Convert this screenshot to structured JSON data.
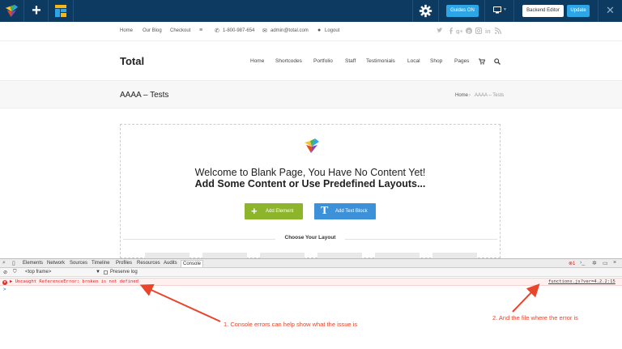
{
  "editor_toolbar": {
    "guides_label": "Guides ON",
    "backend_label": "Backend Editor",
    "update_label": "Update",
    "icons": [
      "vc-logo-icon",
      "add-element-icon",
      "templates-icon",
      "gear-icon",
      "monitor-icon",
      "close-icon"
    ]
  },
  "topbar": {
    "nav": [
      "Home",
      "Our Blog",
      "Checkout"
    ],
    "phone": "1-800-987-654",
    "email": "admin@total.com",
    "logout": "Logout",
    "social": [
      "twitter-icon",
      "facebook-icon",
      "google-plus-icon",
      "pinterest-icon",
      "instagram-icon",
      "linkedin-icon",
      "rss-icon"
    ]
  },
  "header": {
    "brand": "Total",
    "menu": [
      "Home",
      "Shortcodes",
      "Portfolio",
      "Staff",
      "Testimonials",
      "Local",
      "Shop",
      "Pages"
    ]
  },
  "page_header": {
    "title": "AAAA – Tests",
    "breadcrumb_home": "Home",
    "breadcrumb_sep": "›",
    "breadcrumb_current": "AAAA – Tests"
  },
  "blank_page": {
    "line1": "Welcome to Blank Page, You Have No Content Yet!",
    "line2": "Add Some Content or Use Predefined Layouts...",
    "add_element": "Add Element",
    "add_text_block": "Add Text Block",
    "text_block_glyph": "T",
    "choose_layout": "Choose Your Layout"
  },
  "devtools": {
    "tabs": [
      "Elements",
      "Network",
      "Sources",
      "Timeline",
      "Profiles",
      "Resources",
      "Audits",
      "Console"
    ],
    "active_tab": "Console",
    "error_count": "1",
    "frame": "<top frame>",
    "preserve_log": "Preserve log",
    "error_message": "Uncaught ReferenceError: broken is not defined",
    "error_source": "functions.js?ver=4.2.2:15",
    "prompt": ">"
  },
  "annotations": {
    "note1": "1. Console errors can help show what the issue is",
    "note2": "2. And the file where the error is"
  },
  "colors": {
    "toolbar_bg": "#0c3a61",
    "accent_blue": "#2ea6e6",
    "green_button": "#8cb52c",
    "blue_button": "#3d91d8",
    "error_red": "#d22222",
    "annotation_red": "#e8462b"
  }
}
